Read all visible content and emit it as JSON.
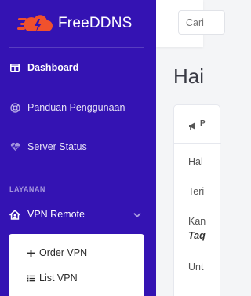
{
  "brand": {
    "name": "FreeDDNS",
    "accent": "#f0512d"
  },
  "sidebar": {
    "background": "#3413b3",
    "items": [
      {
        "label": "Dashboard",
        "icon": "columns-icon"
      },
      {
        "label": "Panduan Penggunaan",
        "icon": "lifebuoy-icon"
      },
      {
        "label": "Server Status",
        "icon": "heartbeat-icon"
      }
    ],
    "section_title": "LAYANAN",
    "vpn_remote": {
      "label": "VPN Remote",
      "icon": "house-user-icon",
      "submenu": [
        {
          "label": "Order VPN",
          "icon": "plus-icon"
        },
        {
          "label": "List VPN",
          "icon": "list-icon"
        }
      ]
    }
  },
  "topbar": {
    "search_placeholder": "Cari"
  },
  "main": {
    "page_title": "Hai",
    "card": {
      "header_icon": "megaphone-icon",
      "header_text": "P",
      "lines": [
        "Hal",
        "Teri",
        "Kan",
        "Taq",
        "Unt"
      ]
    }
  }
}
